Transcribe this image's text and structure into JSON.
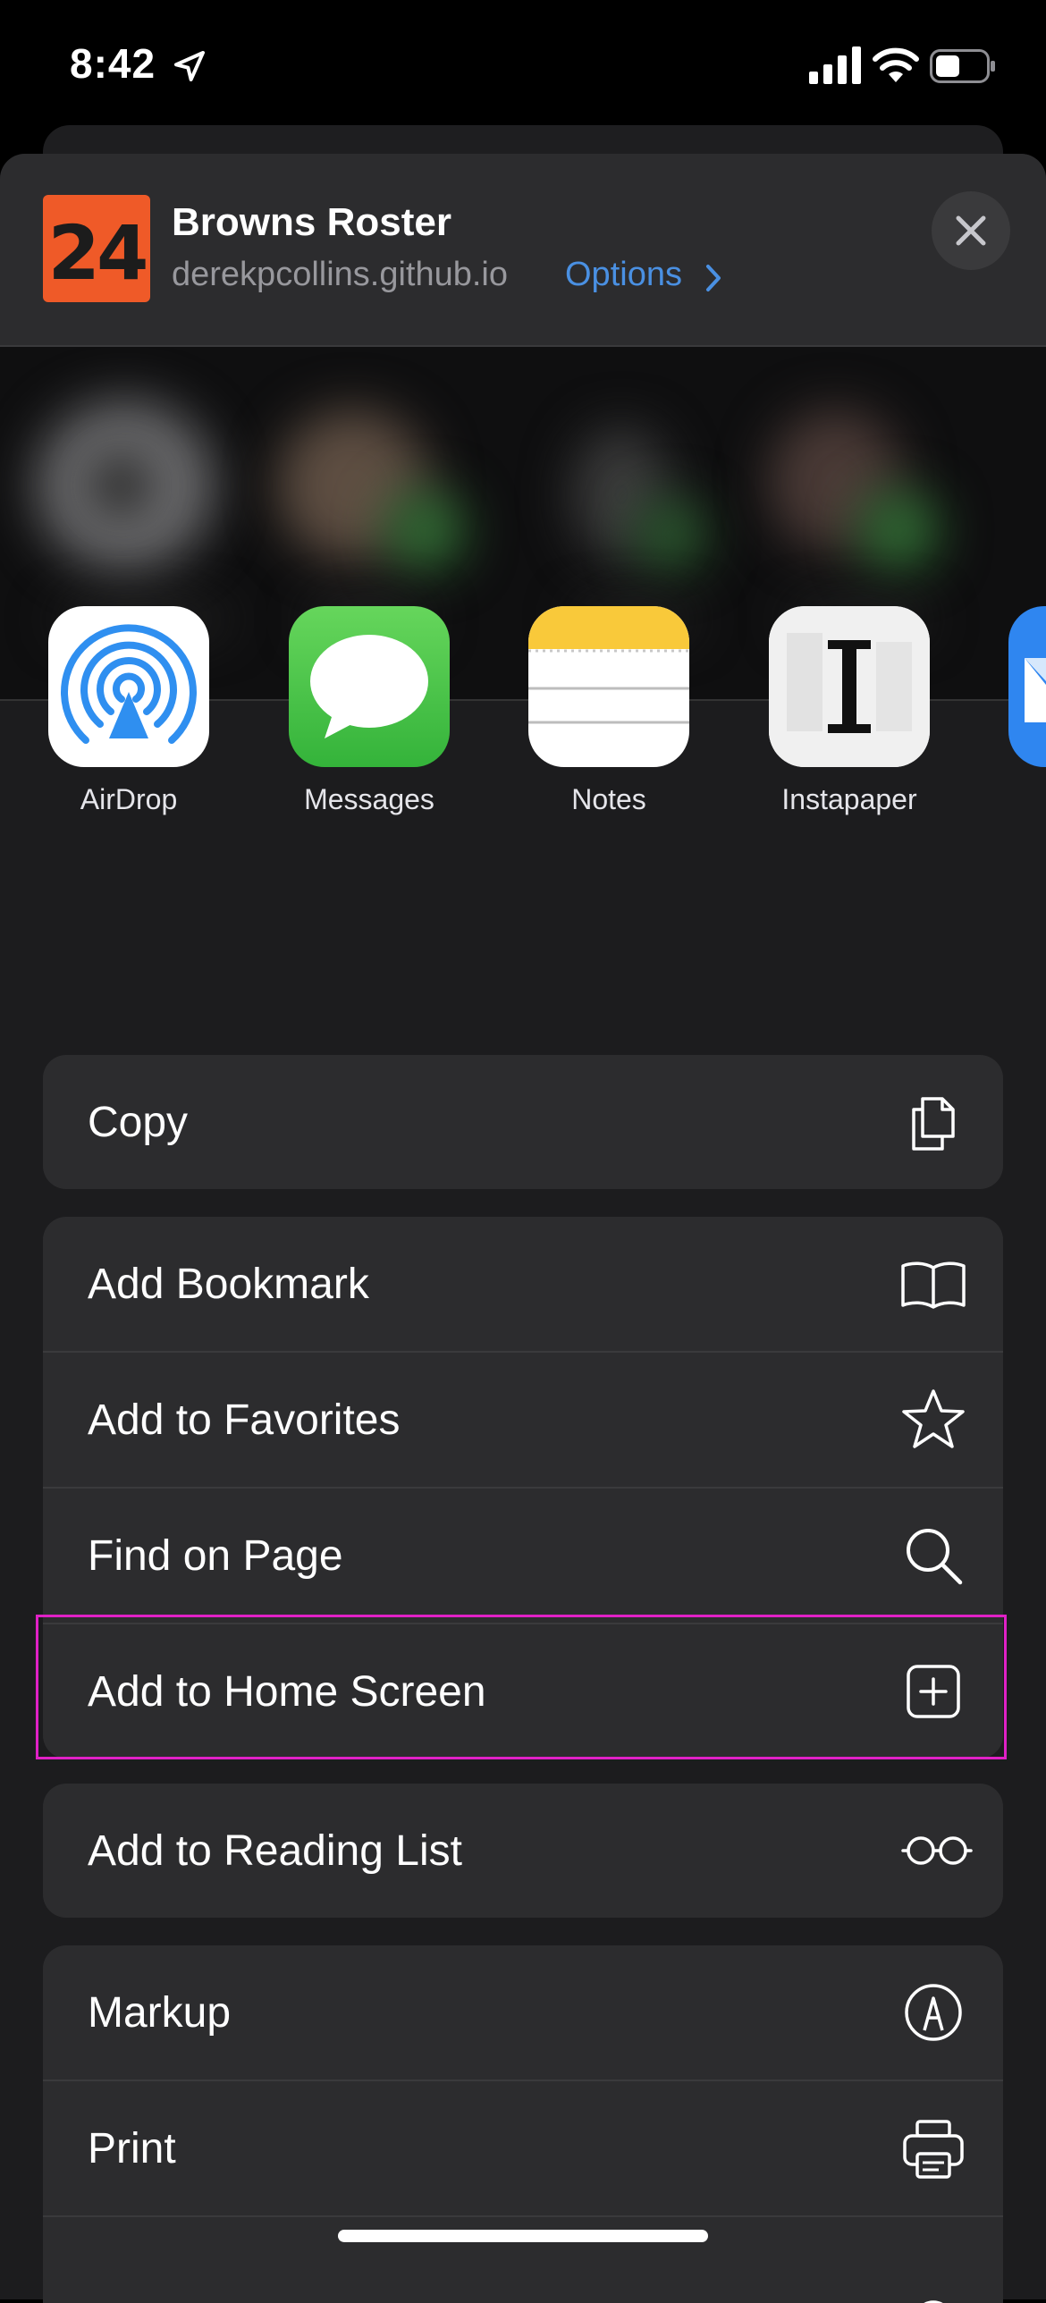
{
  "status_bar": {
    "time": "8:42"
  },
  "share_header": {
    "app_badge": "24",
    "title": "Browns Roster",
    "url": "derekpcollins.github.io",
    "options_label": "Options"
  },
  "apps": [
    {
      "label": "AirDrop"
    },
    {
      "label": "Messages"
    },
    {
      "label": "Notes"
    },
    {
      "label": "Instapaper"
    }
  ],
  "actions": {
    "copy": "Copy",
    "add_bookmark": "Add Bookmark",
    "add_favorites": "Add to Favorites",
    "find_on_page": "Find on Page",
    "add_home_screen": "Add to Home Screen",
    "add_reading_list": "Add to Reading List",
    "markup": "Markup",
    "print": "Print"
  },
  "colors": {
    "accent_link": "#4a90e2",
    "highlight_border": "#e021c6",
    "badge_orange": "#ef5a28"
  }
}
